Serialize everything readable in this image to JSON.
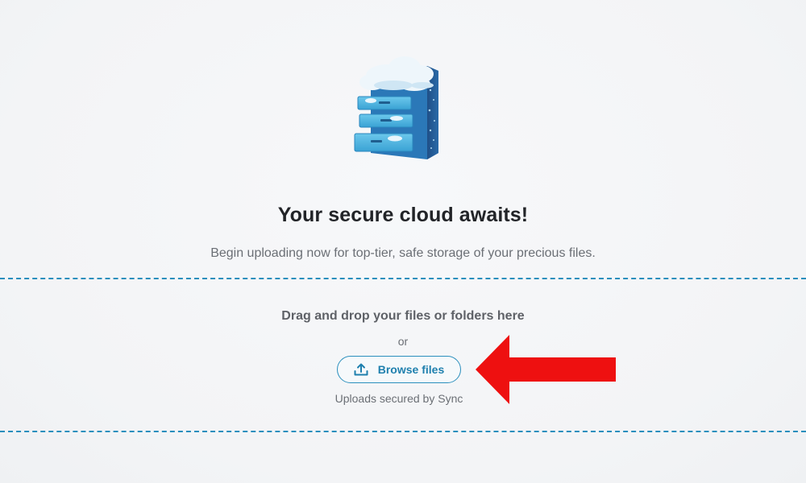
{
  "hero": {
    "illustration_icon": "cloud-file-cabinet-icon"
  },
  "title": "Your secure cloud awaits!",
  "subtitle": "Begin uploading now for top-tier, safe storage of your precious files.",
  "dropzone": {
    "drop_text": "Drag and drop your files or folders here",
    "or_text": "or",
    "browse_label": "Browse files",
    "browse_icon": "upload-icon",
    "secured_text": "Uploads secured by Sync"
  },
  "annotation": {
    "arrow_icon": "red-arrow-left-icon"
  },
  "colors": {
    "accent": "#2a8fbd",
    "arrow": "#ee1010",
    "title": "#222428",
    "muted": "#6b6f75"
  }
}
